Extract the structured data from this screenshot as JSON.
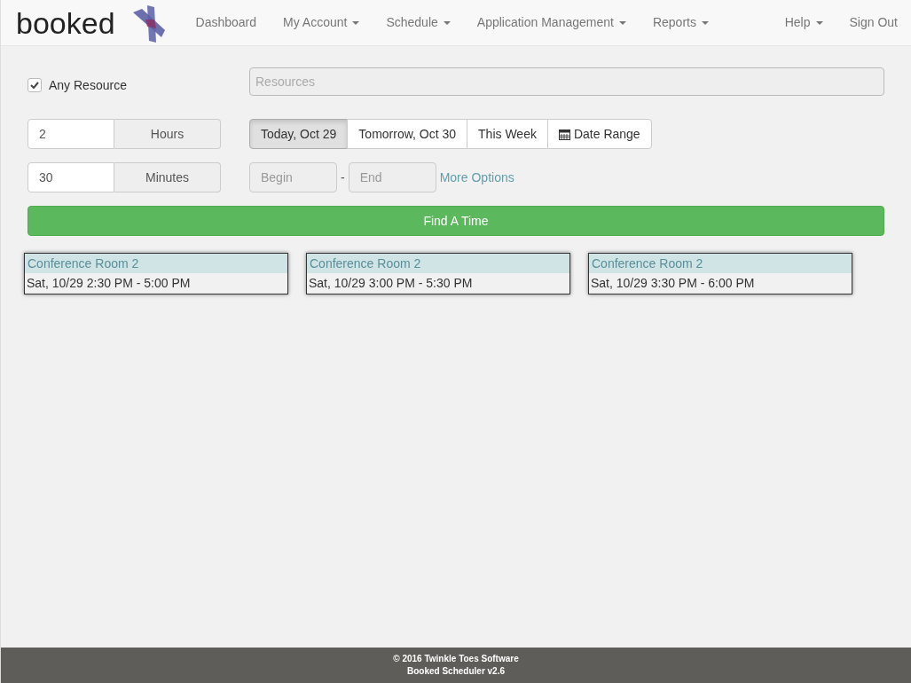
{
  "brand": {
    "name": "booked"
  },
  "nav": [
    {
      "label": "Dashboard",
      "dropdown": false
    },
    {
      "label": "My Account",
      "dropdown": true
    },
    {
      "label": "Schedule",
      "dropdown": true
    },
    {
      "label": "Application Management",
      "dropdown": true
    },
    {
      "label": "Reports",
      "dropdown": true
    }
  ],
  "nav_right": [
    {
      "label": "Help",
      "dropdown": true
    },
    {
      "label": "Sign Out",
      "dropdown": false
    }
  ],
  "any_resource": {
    "label": "Any Resource",
    "checked": true
  },
  "resources": {
    "placeholder": "Resources"
  },
  "duration": [
    {
      "value": "2",
      "unit": "Hours"
    },
    {
      "value": "30",
      "unit": "Minutes"
    }
  ],
  "date_options": [
    {
      "label": "Today, Oct 29",
      "selected": true,
      "kind": "text"
    },
    {
      "label": "Tomorrow, Oct 30",
      "selected": false,
      "kind": "text"
    },
    {
      "label": "This Week",
      "selected": false,
      "kind": "text"
    },
    {
      "label": "Date Range",
      "selected": false,
      "kind": "calendar"
    }
  ],
  "range": {
    "begin_placeholder": "Begin",
    "separator": "-",
    "end_placeholder": "End",
    "more_options": "More Options"
  },
  "find_button": "Find A Time",
  "results": [
    {
      "resource": "Conference Room 2",
      "time": "Sat, 10/29 2:30 PM - 5:00 PM"
    },
    {
      "resource": "Conference Room 2",
      "time": "Sat, 10/29 3:00 PM - 5:30 PM"
    },
    {
      "resource": "Conference Room 2",
      "time": "Sat, 10/29 3:30 PM - 6:00 PM"
    }
  ],
  "footer": [
    "© 2016 Twinkle Toes Software",
    "Booked Scheduler v2.6"
  ]
}
